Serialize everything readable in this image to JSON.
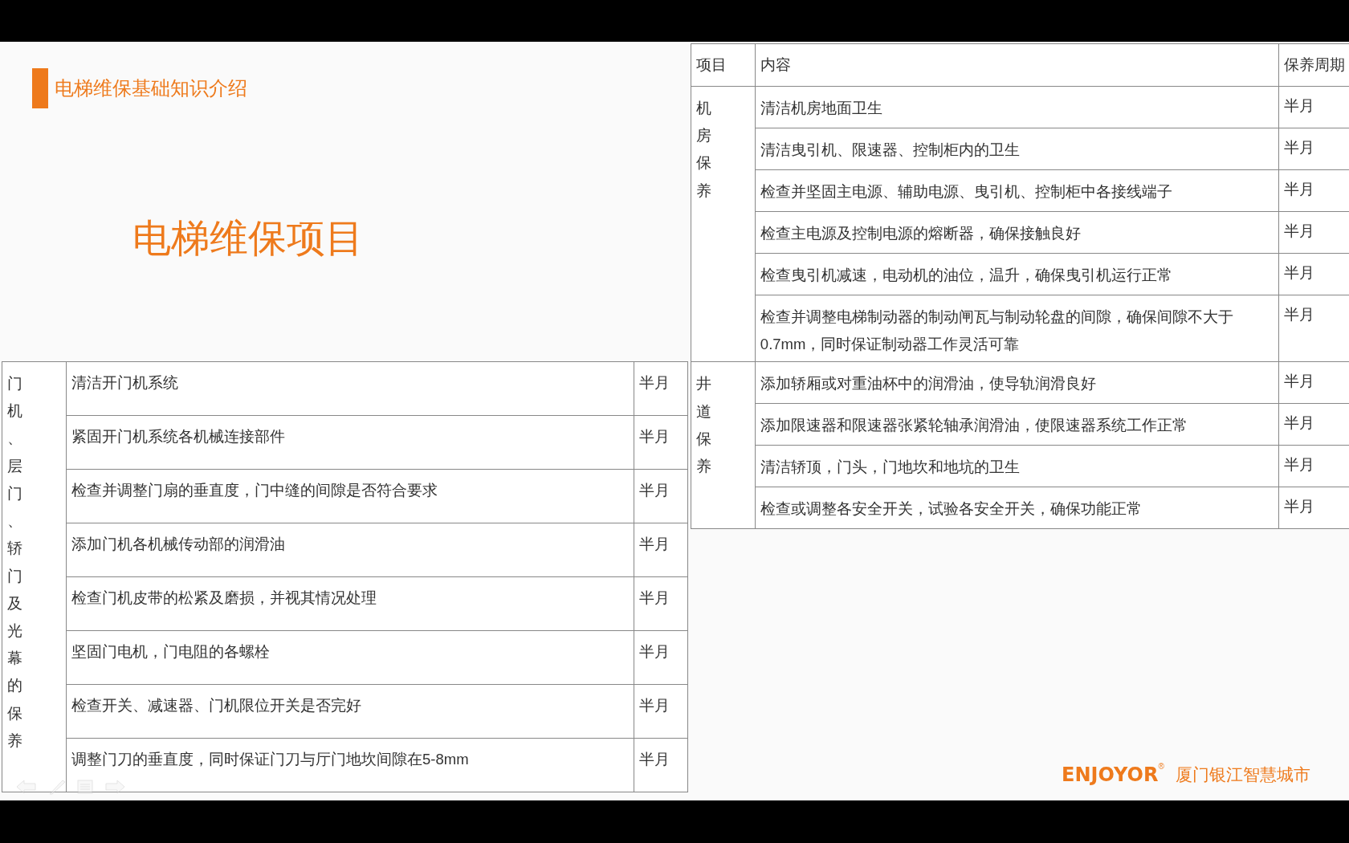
{
  "slide": {
    "section_title": "电梯维保基础知识介绍",
    "heading": "电梯维保项目"
  },
  "door_table": {
    "group": "门机、层门、轿门及光幕的保养",
    "rows": [
      {
        "content": "清洁开门机系统",
        "period": "半月"
      },
      {
        "content": "紧固开门机系统各机械连接部件",
        "period": "半月"
      },
      {
        "content": "检查并调整门扇的垂直度，门中缝的间隙是否符合要求",
        "period": "半月"
      },
      {
        "content": "添加门机各机械传动部的润滑油",
        "period": "半月"
      },
      {
        "content": "检查门机皮带的松紧及磨损，并视其情况处理",
        "period": "半月"
      },
      {
        "content": "坚固门电机，门电阻的各螺栓",
        "period": "半月"
      },
      {
        "content": "检查开关、减速器、门机限位开关是否完好",
        "period": "半月"
      },
      {
        "content": "调整门刀的垂直度，同时保证门刀与厅门地坎间隙在5-8mm",
        "period": "半月"
      }
    ]
  },
  "room_table": {
    "columns": [
      "项目",
      "内容",
      "保养周期"
    ],
    "groups": [
      {
        "label": "机房保养",
        "rows": [
          {
            "content": "清洁机房地面卫生",
            "period": "半月"
          },
          {
            "content": "清洁曳引机、限速器、控制柜内的卫生",
            "period": "半月"
          },
          {
            "content": "检查并坚固主电源、辅助电源、曳引机、控制柜中各接线端子",
            "period": "半月"
          },
          {
            "content": "检查主电源及控制电源的熔断器，确保接触良好",
            "period": "半月"
          },
          {
            "content": "检查曳引机减速，电动机的油位，温升，确保曳引机运行正常",
            "period": "半月"
          },
          {
            "content": "检查并调整电梯制动器的制动闸瓦与制动轮盘的间隙，确保间隙不大于0.7mm，同时保证制动器工作灵活可靠",
            "period": "半月"
          }
        ]
      },
      {
        "label": "井道保养",
        "rows": [
          {
            "content": "添加轿厢或对重油杯中的润滑油，使导轨润滑良好",
            "period": "半月"
          },
          {
            "content": "添加限速器和限速器张紧轮轴承润滑油，使限速器系统工作正常",
            "period": "半月"
          },
          {
            "content": "清洁轿顶，门头，门地坎和地坑的卫生",
            "period": "半月"
          },
          {
            "content": "检查或调整各安全开关，试验各安全开关，确保功能正常",
            "period": "半月"
          }
        ]
      }
    ]
  },
  "logo": {
    "brand": "ENJOYOR",
    "mark": "®",
    "company": "厦门银江智慧城市"
  }
}
